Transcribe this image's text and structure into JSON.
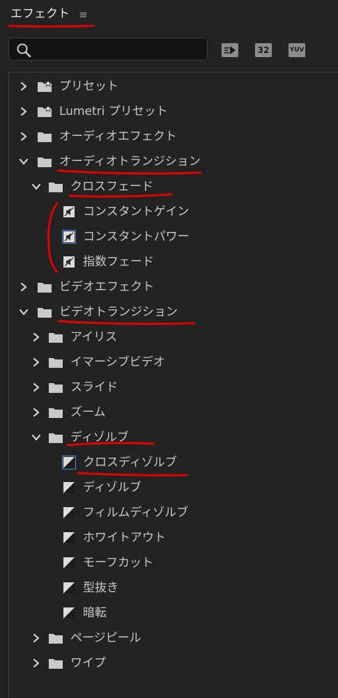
{
  "header": {
    "title": "エフェクト",
    "menu_icon": "hamburger-menu-icon"
  },
  "search": {
    "value": "",
    "placeholder": ""
  },
  "filter_buttons": [
    {
      "name": "accelerated-effects-filter-button",
      "label": ""
    },
    {
      "name": "32-bit-filter-button",
      "label": "32"
    },
    {
      "name": "yuv-filter-button",
      "label": "YUV"
    }
  ],
  "tree": [
    {
      "label": "プリセット",
      "type": "folder-star",
      "level": 0,
      "expanded": false
    },
    {
      "label": "Lumetri プリセット",
      "type": "folder-star",
      "level": 0,
      "expanded": false
    },
    {
      "label": "オーディオエフェクト",
      "type": "folder",
      "level": 0,
      "expanded": false
    },
    {
      "label": "オーディオトランジション",
      "type": "folder",
      "level": 0,
      "expanded": true
    },
    {
      "label": "クロスフェード",
      "type": "folder",
      "level": 1,
      "expanded": true
    },
    {
      "label": "コンスタントゲイン",
      "type": "audio-transition",
      "level": 2
    },
    {
      "label": "コンスタントパワー",
      "type": "audio-transition",
      "level": 2,
      "highlight": true
    },
    {
      "label": "指数フェード",
      "type": "audio-transition",
      "level": 2
    },
    {
      "label": "ビデオエフェクト",
      "type": "folder",
      "level": 0,
      "expanded": false
    },
    {
      "label": "ビデオトランジション",
      "type": "folder",
      "level": 0,
      "expanded": true
    },
    {
      "label": "アイリス",
      "type": "folder",
      "level": 1,
      "expanded": false
    },
    {
      "label": "イマーシブビデオ",
      "type": "folder",
      "level": 1,
      "expanded": false
    },
    {
      "label": "スライド",
      "type": "folder",
      "level": 1,
      "expanded": false
    },
    {
      "label": "ズーム",
      "type": "folder",
      "level": 1,
      "expanded": false
    },
    {
      "label": "ディゾルブ",
      "type": "folder",
      "level": 1,
      "expanded": true
    },
    {
      "label": "クロスディゾルブ",
      "type": "video-transition",
      "level": 2,
      "highlight": true
    },
    {
      "label": "ディゾルブ",
      "type": "video-transition",
      "level": 2
    },
    {
      "label": "フィルムディゾルブ",
      "type": "video-transition",
      "level": 2
    },
    {
      "label": "ホワイトアウト",
      "type": "video-transition",
      "level": 2
    },
    {
      "label": "モーフカット",
      "type": "video-transition",
      "level": 2
    },
    {
      "label": "型抜き",
      "type": "video-transition",
      "level": 2
    },
    {
      "label": "暗転",
      "type": "video-transition",
      "level": 2
    },
    {
      "label": "ページピール",
      "type": "folder",
      "level": 1,
      "expanded": false
    },
    {
      "label": "ワイプ",
      "type": "folder",
      "level": 1,
      "expanded": false
    }
  ],
  "colors": {
    "background": "#232323",
    "text": "#c8c8c8",
    "annotation": "#e00000",
    "highlight_border": "#4a8ad8"
  }
}
